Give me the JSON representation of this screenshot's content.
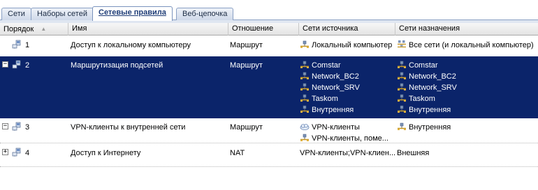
{
  "tabs": [
    {
      "label": "Сети",
      "active": false
    },
    {
      "label": "Наборы сетей",
      "active": false
    },
    {
      "label": "Сетевые правила",
      "active": true
    },
    {
      "label": "Веб-цепочка",
      "active": false
    }
  ],
  "columns": {
    "order": "Порядок",
    "name": "Имя",
    "relation": "Отношение",
    "source": "Сети источника",
    "dest": "Сети назначения"
  },
  "rows": [
    {
      "order": "1",
      "name": "Доступ к локальному компьютеру",
      "relation": "Маршрут",
      "source": [
        {
          "text": "Локальный компьютер",
          "icon": "network-icon"
        }
      ],
      "dest": [
        {
          "text": "Все сети (и локальный компьютер)",
          "icon": "all-networks-icon"
        }
      ],
      "expander": "",
      "selected": false
    },
    {
      "order": "2",
      "name": "Маршрутизация подсетей",
      "relation": "Маршрут",
      "source": [
        {
          "text": "Comstar",
          "icon": "network-icon"
        },
        {
          "text": "Network_BC2",
          "icon": "network-icon"
        },
        {
          "text": "Network_SRV",
          "icon": "network-icon"
        },
        {
          "text": "Taskom",
          "icon": "network-icon"
        },
        {
          "text": "Внутренняя",
          "icon": "network-icon"
        }
      ],
      "dest": [
        {
          "text": "Comstar",
          "icon": "network-icon"
        },
        {
          "text": "Network_BC2",
          "icon": "network-icon"
        },
        {
          "text": "Network_SRV",
          "icon": "network-icon"
        },
        {
          "text": "Taskom",
          "icon": "network-icon"
        },
        {
          "text": "Внутренняя",
          "icon": "network-icon"
        }
      ],
      "expander": "−",
      "selected": true
    },
    {
      "order": "3",
      "name": "VPN-клиенты к внутренней сети",
      "relation": "Маршрут",
      "source": [
        {
          "text": "VPN-клиенты",
          "icon": "vpn-cloud-icon"
        },
        {
          "text": "VPN-клиенты, поме...",
          "icon": "network-icon"
        }
      ],
      "dest": [
        {
          "text": "Внутренняя",
          "icon": "network-icon"
        }
      ],
      "expander": "−",
      "selected": false
    },
    {
      "order": "4",
      "name": "Доступ к Интернету",
      "relation": "NAT",
      "source": [
        {
          "text": "VPN-клиенты;VPN-клиен...",
          "icon": ""
        }
      ],
      "dest": [
        {
          "text": "Внешняя",
          "icon": ""
        }
      ],
      "expander": "+",
      "selected": false
    }
  ],
  "colors": {
    "selection": "#0b246a",
    "tab_active_text": "#1f3d77"
  }
}
